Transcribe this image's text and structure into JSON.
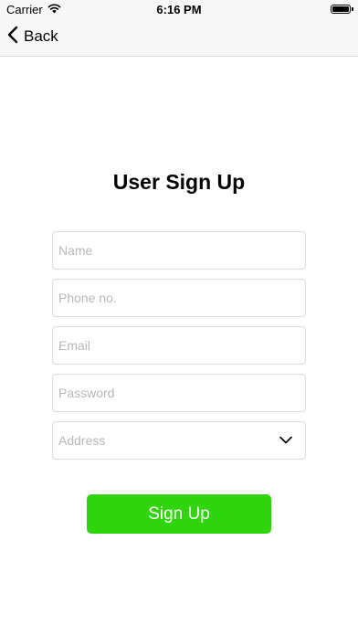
{
  "status_bar": {
    "carrier": "Carrier",
    "time": "6:16 PM",
    "icons": [
      "wifi-icon",
      "battery-icon"
    ]
  },
  "nav": {
    "back_label": "Back",
    "back_icon": "chevron-left-icon"
  },
  "page": {
    "title": "User Sign Up"
  },
  "form": {
    "name": {
      "value": "",
      "placeholder": "Name"
    },
    "phone": {
      "value": "",
      "placeholder": "Phone no."
    },
    "email": {
      "value": "",
      "placeholder": "Email"
    },
    "password": {
      "value": "",
      "placeholder": "Password"
    },
    "address": {
      "selected": "Address",
      "icon": "chevron-down-icon"
    }
  },
  "actions": {
    "signup_label": "Sign Up"
  },
  "colors": {
    "accent": "#2fd60e",
    "placeholder": "#b8b8b8",
    "border": "#dcdcdc",
    "bar_background": "#f7f7f7"
  }
}
